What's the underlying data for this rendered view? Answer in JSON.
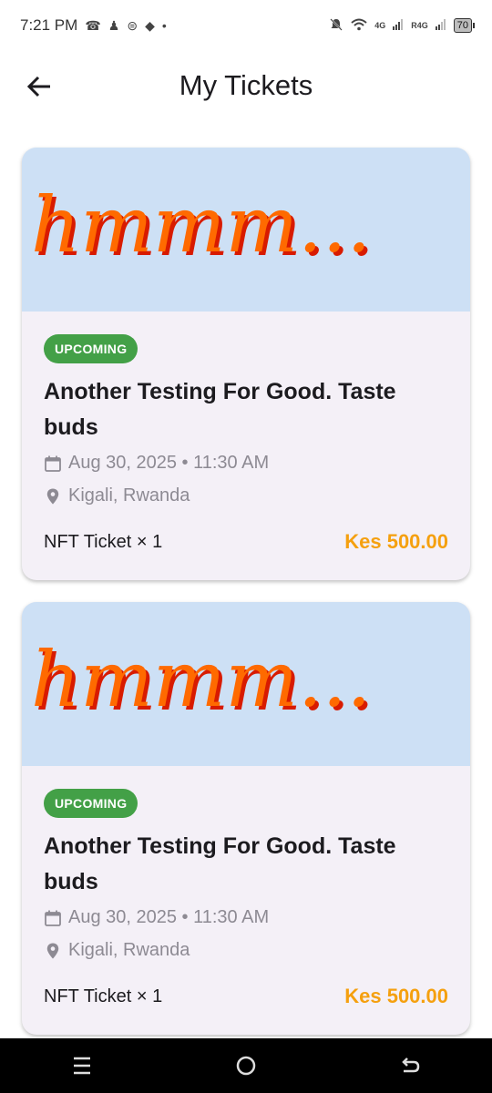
{
  "status_bar": {
    "time": "7:21 PM",
    "network_1": "4G",
    "network_2": "R4G",
    "battery": "70"
  },
  "header": {
    "title": "My Tickets"
  },
  "tickets": [
    {
      "badge": "UPCOMING",
      "title": "Another Testing For Good. Taste buds",
      "date": "Aug 30, 2025 • 11:30 AM",
      "location": "Kigali, Rwanda",
      "ticket_type": "NFT Ticket × 1",
      "price": "Kes 500.00",
      "banner_text": "hmmm..."
    },
    {
      "badge": "UPCOMING",
      "title": "Another Testing For Good. Taste buds",
      "date": "Aug 30, 2025 • 11:30 AM",
      "location": "Kigali, Rwanda",
      "ticket_type": "NFT Ticket × 1",
      "price": "Kes 500.00",
      "banner_text": "hmmm..."
    }
  ],
  "colors": {
    "badge": "#43a047",
    "price": "#f5a00f",
    "banner_bg": "#cde0f5",
    "card_bg": "#f4f0f7"
  }
}
